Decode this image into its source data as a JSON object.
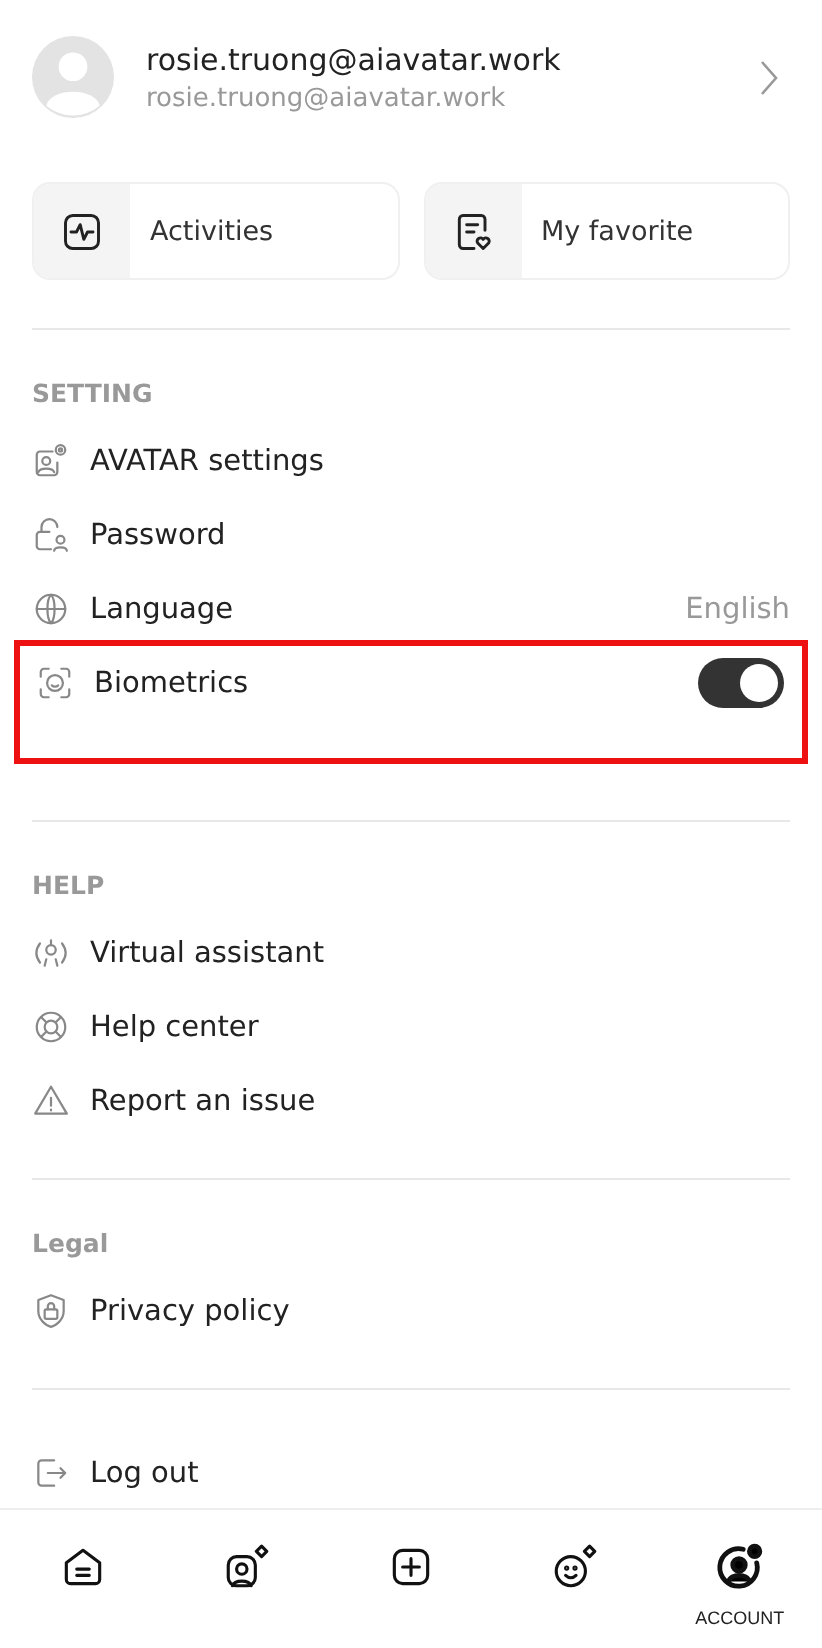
{
  "profile": {
    "name": "rosie.truong@aiavatar.work",
    "email": "rosie.truong@aiavatar.work"
  },
  "shortcuts": [
    {
      "label": "Activities"
    },
    {
      "label": "My favorite"
    }
  ],
  "sections": [
    {
      "title": "SETTING",
      "items": [
        {
          "kind": "link",
          "label": "AVATAR settings",
          "highlighted": false
        },
        {
          "kind": "link",
          "label": "Password",
          "highlighted": false
        },
        {
          "kind": "value",
          "label": "Language",
          "value": "English",
          "highlighted": false
        },
        {
          "kind": "toggle",
          "label": "Biometrics",
          "on": true,
          "highlighted": true
        }
      ]
    },
    {
      "title": "HELP",
      "items": [
        {
          "kind": "link",
          "label": "Virtual assistant",
          "highlighted": false
        },
        {
          "kind": "link",
          "label": "Help center",
          "highlighted": false
        },
        {
          "kind": "link",
          "label": "Report an issue",
          "highlighted": false
        }
      ]
    },
    {
      "title": "Legal",
      "items": [
        {
          "kind": "link",
          "label": "Privacy policy",
          "highlighted": false
        }
      ]
    }
  ],
  "logout": {
    "label": "Log out"
  },
  "nav": [
    {
      "selected": false
    },
    {
      "selected": false
    },
    {
      "selected": false
    },
    {
      "selected": false
    },
    {
      "label": "ACCOUNT",
      "selected": true
    }
  ]
}
